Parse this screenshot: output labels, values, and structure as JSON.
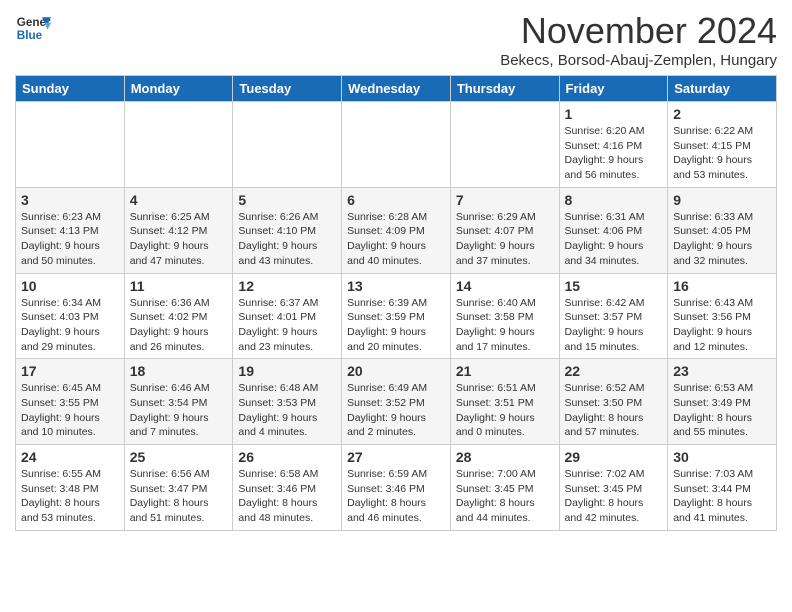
{
  "logo": {
    "line1": "General",
    "line2": "Blue"
  },
  "title": "November 2024",
  "subtitle": "Bekecs, Borsod-Abauj-Zemplen, Hungary",
  "weekdays": [
    "Sunday",
    "Monday",
    "Tuesday",
    "Wednesday",
    "Thursday",
    "Friday",
    "Saturday"
  ],
  "weeks": [
    [
      {
        "day": "",
        "info": ""
      },
      {
        "day": "",
        "info": ""
      },
      {
        "day": "",
        "info": ""
      },
      {
        "day": "",
        "info": ""
      },
      {
        "day": "",
        "info": ""
      },
      {
        "day": "1",
        "info": "Sunrise: 6:20 AM\nSunset: 4:16 PM\nDaylight: 9 hours and 56 minutes."
      },
      {
        "day": "2",
        "info": "Sunrise: 6:22 AM\nSunset: 4:15 PM\nDaylight: 9 hours and 53 minutes."
      }
    ],
    [
      {
        "day": "3",
        "info": "Sunrise: 6:23 AM\nSunset: 4:13 PM\nDaylight: 9 hours and 50 minutes."
      },
      {
        "day": "4",
        "info": "Sunrise: 6:25 AM\nSunset: 4:12 PM\nDaylight: 9 hours and 47 minutes."
      },
      {
        "day": "5",
        "info": "Sunrise: 6:26 AM\nSunset: 4:10 PM\nDaylight: 9 hours and 43 minutes."
      },
      {
        "day": "6",
        "info": "Sunrise: 6:28 AM\nSunset: 4:09 PM\nDaylight: 9 hours and 40 minutes."
      },
      {
        "day": "7",
        "info": "Sunrise: 6:29 AM\nSunset: 4:07 PM\nDaylight: 9 hours and 37 minutes."
      },
      {
        "day": "8",
        "info": "Sunrise: 6:31 AM\nSunset: 4:06 PM\nDaylight: 9 hours and 34 minutes."
      },
      {
        "day": "9",
        "info": "Sunrise: 6:33 AM\nSunset: 4:05 PM\nDaylight: 9 hours and 32 minutes."
      }
    ],
    [
      {
        "day": "10",
        "info": "Sunrise: 6:34 AM\nSunset: 4:03 PM\nDaylight: 9 hours and 29 minutes."
      },
      {
        "day": "11",
        "info": "Sunrise: 6:36 AM\nSunset: 4:02 PM\nDaylight: 9 hours and 26 minutes."
      },
      {
        "day": "12",
        "info": "Sunrise: 6:37 AM\nSunset: 4:01 PM\nDaylight: 9 hours and 23 minutes."
      },
      {
        "day": "13",
        "info": "Sunrise: 6:39 AM\nSunset: 3:59 PM\nDaylight: 9 hours and 20 minutes."
      },
      {
        "day": "14",
        "info": "Sunrise: 6:40 AM\nSunset: 3:58 PM\nDaylight: 9 hours and 17 minutes."
      },
      {
        "day": "15",
        "info": "Sunrise: 6:42 AM\nSunset: 3:57 PM\nDaylight: 9 hours and 15 minutes."
      },
      {
        "day": "16",
        "info": "Sunrise: 6:43 AM\nSunset: 3:56 PM\nDaylight: 9 hours and 12 minutes."
      }
    ],
    [
      {
        "day": "17",
        "info": "Sunrise: 6:45 AM\nSunset: 3:55 PM\nDaylight: 9 hours and 10 minutes."
      },
      {
        "day": "18",
        "info": "Sunrise: 6:46 AM\nSunset: 3:54 PM\nDaylight: 9 hours and 7 minutes."
      },
      {
        "day": "19",
        "info": "Sunrise: 6:48 AM\nSunset: 3:53 PM\nDaylight: 9 hours and 4 minutes."
      },
      {
        "day": "20",
        "info": "Sunrise: 6:49 AM\nSunset: 3:52 PM\nDaylight: 9 hours and 2 minutes."
      },
      {
        "day": "21",
        "info": "Sunrise: 6:51 AM\nSunset: 3:51 PM\nDaylight: 9 hours and 0 minutes."
      },
      {
        "day": "22",
        "info": "Sunrise: 6:52 AM\nSunset: 3:50 PM\nDaylight: 8 hours and 57 minutes."
      },
      {
        "day": "23",
        "info": "Sunrise: 6:53 AM\nSunset: 3:49 PM\nDaylight: 8 hours and 55 minutes."
      }
    ],
    [
      {
        "day": "24",
        "info": "Sunrise: 6:55 AM\nSunset: 3:48 PM\nDaylight: 8 hours and 53 minutes."
      },
      {
        "day": "25",
        "info": "Sunrise: 6:56 AM\nSunset: 3:47 PM\nDaylight: 8 hours and 51 minutes."
      },
      {
        "day": "26",
        "info": "Sunrise: 6:58 AM\nSunset: 3:46 PM\nDaylight: 8 hours and 48 minutes."
      },
      {
        "day": "27",
        "info": "Sunrise: 6:59 AM\nSunset: 3:46 PM\nDaylight: 8 hours and 46 minutes."
      },
      {
        "day": "28",
        "info": "Sunrise: 7:00 AM\nSunset: 3:45 PM\nDaylight: 8 hours and 44 minutes."
      },
      {
        "day": "29",
        "info": "Sunrise: 7:02 AM\nSunset: 3:45 PM\nDaylight: 8 hours and 42 minutes."
      },
      {
        "day": "30",
        "info": "Sunrise: 7:03 AM\nSunset: 3:44 PM\nDaylight: 8 hours and 41 minutes."
      }
    ]
  ]
}
